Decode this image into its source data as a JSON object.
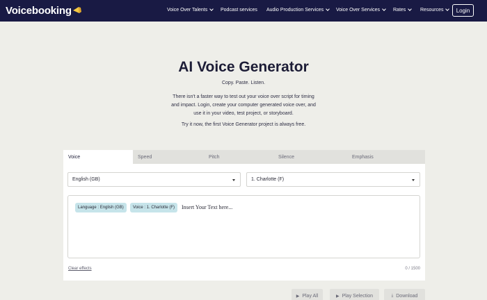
{
  "brand": {
    "name": "Voicebooking"
  },
  "nav": {
    "items": [
      {
        "label": "Voice Over Talents",
        "has_dropdown": true
      },
      {
        "label": "Podcast services",
        "has_dropdown": false
      },
      {
        "label": "Audio Production Services",
        "has_dropdown": true
      },
      {
        "label": "Voice Over Services",
        "has_dropdown": true
      },
      {
        "label": "Rates",
        "has_dropdown": true
      },
      {
        "label": "Resources",
        "has_dropdown": true
      }
    ],
    "login_label": "Login"
  },
  "hero": {
    "title": "AI Voice Generator",
    "subtitle": "Copy. Paste. Listen.",
    "description": "There isn't a faster way to test out your voice over script for timing and impact. Login, create your computer generated voice over, and use it in your video, test project, or storyboard.",
    "try_text": "Try it now, the first Voice Generator project is always free."
  },
  "generator": {
    "tabs": [
      {
        "label": "Voice",
        "active": true
      },
      {
        "label": "Speed",
        "active": false
      },
      {
        "label": "Pitch",
        "active": false
      },
      {
        "label": "Silence",
        "active": false
      },
      {
        "label": "Emphasis",
        "active": false
      }
    ],
    "language_select": {
      "value": "English (GB)"
    },
    "voice_select": {
      "value": "1. Charlotte (F)"
    },
    "editor": {
      "tags": [
        {
          "label": "Language : English (GB)"
        },
        {
          "label": "Voice : 1. Charlotte (F)"
        }
      ],
      "placeholder": "Insert Your Text here..."
    },
    "clear_label": "Clear effects",
    "counter": "0 / 1500"
  },
  "actions": [
    {
      "label": "Play All",
      "icon": "play-icon"
    },
    {
      "label": "Play Selection",
      "icon": "play-icon"
    },
    {
      "label": "Download",
      "icon": "download-icon"
    }
  ],
  "colors": {
    "nav_bg": "#191a44",
    "page_bg": "#eeeee9",
    "tag_bg": "#c6e4ea",
    "logo_accent": "#f5c842"
  }
}
